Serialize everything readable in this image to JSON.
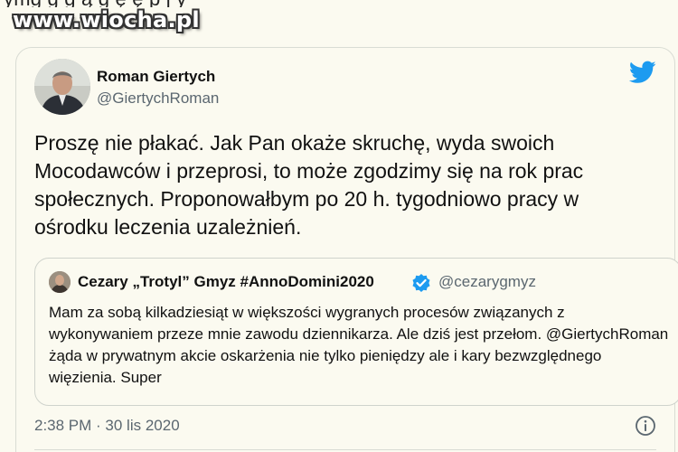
{
  "watermark": "www.wiocha.pl",
  "top_fragment": "ymg g g ą g ę ę p j y",
  "tweet": {
    "author_name": "Roman Giertych",
    "author_handle": "@GiertychRoman",
    "text": "Proszę nie płakać. Jak Pan okaże skruchę, wyda swoich Mocodawców i przeprosi, to może zgodzimy się na rok prac społecznych. Proponowałbym po 20 h. tygodniowo pracy w ośrodku leczenia uzależnień.",
    "timestamp": "2:38 PM · 30 lis 2020",
    "icons": {
      "brand": "twitter-bird-icon",
      "info": "info-icon"
    }
  },
  "quoted_tweet": {
    "author_name": "Cezary „Trotyl” Gmyz #AnnoDomini2020",
    "author_handle": "@cezarygmyz",
    "verified": true,
    "text": "Mam za sobą kilkadziesiąt w większości wygranych procesów związanych z wykonywaniem przeze mnie zawodu dziennikarza. Ale dziś jest przełom. @GiertychRoman żąda w prywatnym akcie oskarżenia nie tylko pieniędzy ale i kary bezwzględnego więzienia. Super"
  },
  "colors": {
    "background": "#fbfaf0",
    "twitter_blue": "#1d9bf0",
    "secondary_text": "#5b6770",
    "border": "#d9dcd4"
  }
}
